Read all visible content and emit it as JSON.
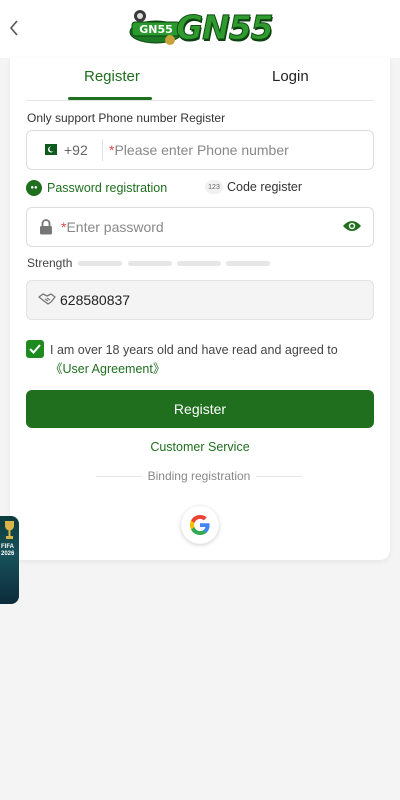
{
  "header": {
    "back_icon": "chevron-left-icon",
    "logo_text": "GN55"
  },
  "tabs": [
    {
      "label": "Register",
      "active": true
    },
    {
      "label": "Login",
      "active": false
    }
  ],
  "form": {
    "hint": "Only support Phone number Register",
    "phone": {
      "country_code": "+92",
      "flag_icon": "pakistan-flag-icon",
      "required_mark": "*",
      "placeholder": "Please enter Phone number"
    },
    "options": [
      {
        "label": "Password registration",
        "selected": true
      },
      {
        "label": "Code register",
        "badge": "123"
      }
    ],
    "password": {
      "required_mark": "*",
      "placeholder": "Enter password",
      "lock_icon": "lock-icon",
      "eye_icon": "eye-icon"
    },
    "strength": {
      "label": "Strength",
      "segments": 4,
      "filled": 0
    },
    "invite_code": {
      "value": "628580837",
      "icon": "handshake-icon"
    },
    "agreement": {
      "checked": true,
      "text": "I am over 18 years old and have read and agreed to ",
      "link": "《User Agreement》"
    },
    "submit_label": "Register",
    "customer_service": "Customer Service",
    "binding_label": "Binding registration",
    "social": [
      {
        "name": "google-icon"
      }
    ]
  },
  "floating_banner": {
    "text": "FIFA 2026"
  },
  "colors": {
    "primary": "#1f6f1f",
    "required": "#e04848",
    "background": "#f4f4f4"
  }
}
